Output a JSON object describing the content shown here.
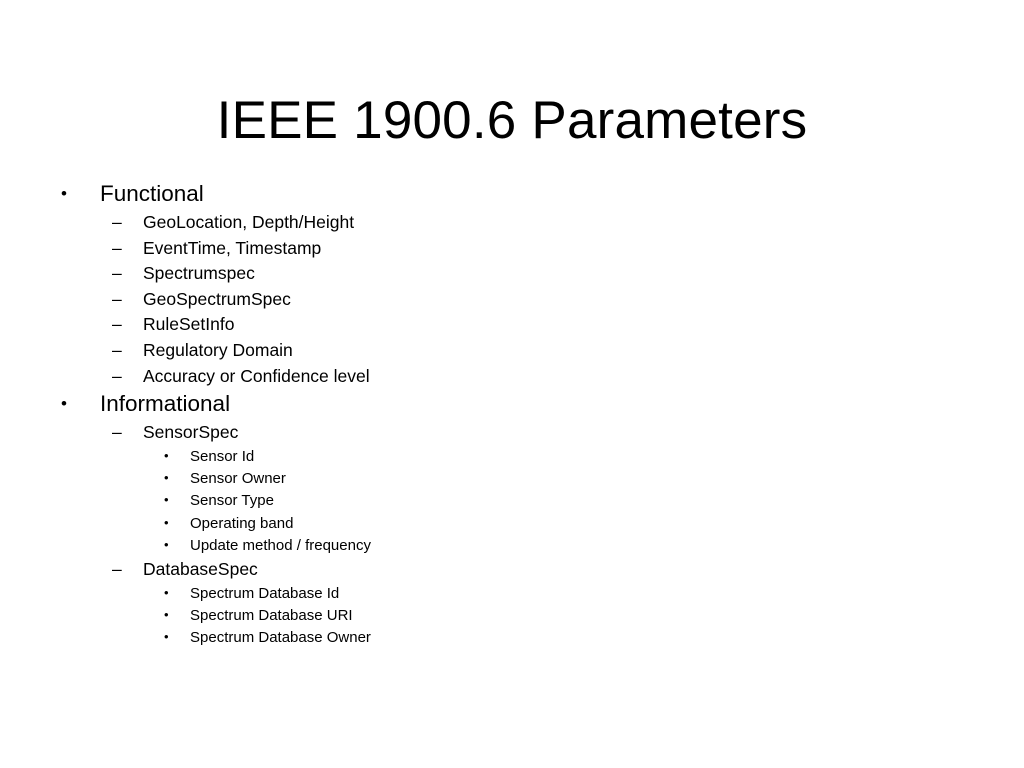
{
  "slide": {
    "title": "IEEE 1900.6 Parameters",
    "background_color": "#FFFFFF",
    "text_color": "#000000",
    "markers": {
      "level1": "•",
      "level2": "–",
      "level3": "•"
    },
    "outline": [
      {
        "level": 1,
        "text": "Functional"
      },
      {
        "level": 2,
        "text": "GeoLocation, Depth/Height"
      },
      {
        "level": 2,
        "text": "EventTime, Timestamp"
      },
      {
        "level": 2,
        "text": "Spectrumspec"
      },
      {
        "level": 2,
        "text": "GeoSpectrumSpec"
      },
      {
        "level": 2,
        "text": "RuleSetInfo"
      },
      {
        "level": 2,
        "text": "Regulatory Domain"
      },
      {
        "level": 2,
        "text": "Accuracy or Confidence level"
      },
      {
        "level": 1,
        "text": "Informational"
      },
      {
        "level": 2,
        "text": "SensorSpec"
      },
      {
        "level": 3,
        "text": "Sensor Id"
      },
      {
        "level": 3,
        "text": "Sensor Owner"
      },
      {
        "level": 3,
        "text": "Sensor Type"
      },
      {
        "level": 3,
        "text": "Operating band"
      },
      {
        "level": 3,
        "text": "Update method / frequency"
      },
      {
        "level": 2,
        "text": "DatabaseSpec"
      },
      {
        "level": 3,
        "text": "Spectrum Database Id"
      },
      {
        "level": 3,
        "text": "Spectrum Database URI"
      },
      {
        "level": 3,
        "text": "Spectrum Database Owner"
      }
    ]
  }
}
